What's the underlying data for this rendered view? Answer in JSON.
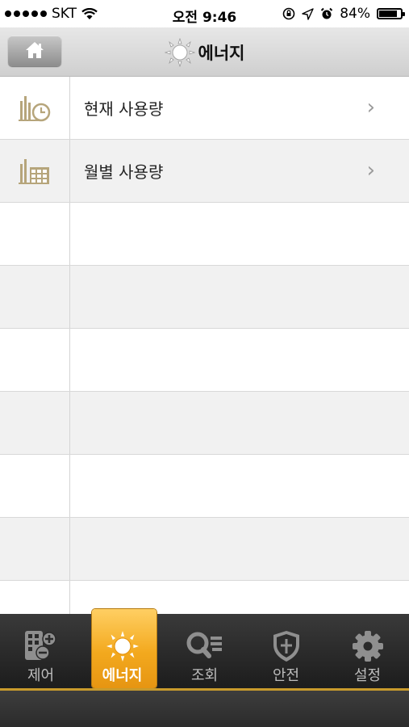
{
  "status_bar": {
    "carrier": "SKT",
    "time": "오전 9:46",
    "battery": "84%",
    "battery_level": 0.84,
    "icons": [
      "signal-dots-icon",
      "wifi-icon",
      "orientation-lock-icon",
      "location-arrow-icon",
      "alarm-icon",
      "battery-icon"
    ]
  },
  "navbar": {
    "title": "에너지",
    "home_icon": "home-icon",
    "title_icon": "sun-icon"
  },
  "list": {
    "items": [
      {
        "label": "현재 사용량",
        "icon": "bar-chart-clock-icon"
      },
      {
        "label": "월별 사용량",
        "icon": "bar-chart-calendar-icon"
      }
    ],
    "empty_rows": 7
  },
  "tabbar": {
    "tabs": [
      {
        "label": "제어",
        "icon": "control-remote-icon",
        "active": false
      },
      {
        "label": "에너지",
        "icon": "sun-icon",
        "active": true
      },
      {
        "label": "조회",
        "icon": "search-list-icon",
        "active": false
      },
      {
        "label": "안전",
        "icon": "shield-icon",
        "active": false
      },
      {
        "label": "설정",
        "icon": "gear-icon",
        "active": false
      }
    ]
  },
  "colors": {
    "accent": "#f3a91e",
    "icon_gold": "#b6a57b",
    "tabbar_bg": "#262626"
  }
}
